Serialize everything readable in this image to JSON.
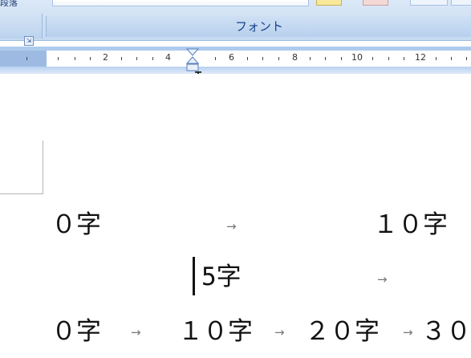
{
  "ribbon": {
    "left_label": "段落",
    "font_group_label": "フォント",
    "launcher_glyph": "⇲"
  },
  "ruler": {
    "numbers": [
      "2",
      "4",
      "6",
      "8",
      "10",
      "12"
    ],
    "ibeam_glyph": "I"
  },
  "document": {
    "line1": {
      "left": "０字",
      "right": "１０字"
    },
    "line2": {
      "text": "5字"
    },
    "line3": {
      "seg1": "０字",
      "seg2": "１０字",
      "seg3": "２０字",
      "seg4": "３０"
    },
    "tab_glyph": "→"
  },
  "colors": {
    "ribbon_text": "#15428b",
    "ruler_bg": "#aecbee",
    "tab_arrow": "#777777"
  }
}
